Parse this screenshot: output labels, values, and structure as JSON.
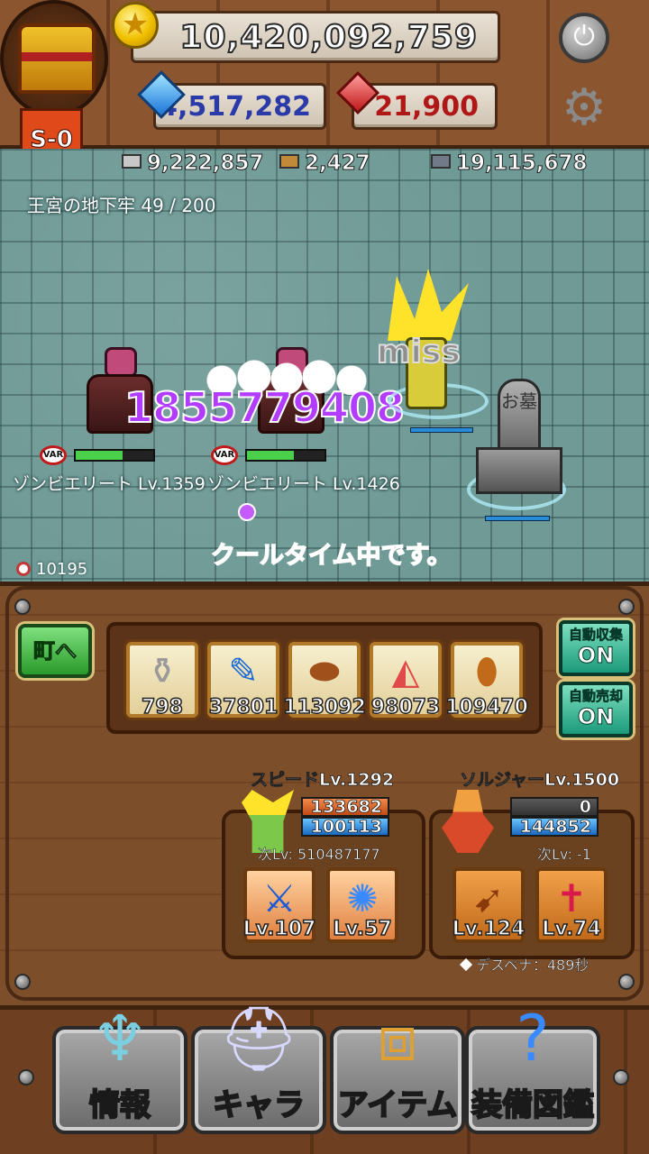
{
  "hud": {
    "gold": "10,420,092,759",
    "gems": "4,517,282",
    "rubies": "21,900",
    "stage": "S-0",
    "colors": {
      "gold_coin": "#f0c000",
      "gem": "#1b74d8",
      "ruby": "#c01a1a"
    }
  },
  "resources": {
    "ore": "9,222,857",
    "wood": "2,427",
    "stone": "19,115,678"
  },
  "field": {
    "dungeon": "王宮の地下牢 49 / 200",
    "damage": "1855779408",
    "miss": "miss",
    "cooldown": "クールタイム中です。",
    "kill_count": "10195",
    "grave_text": "お墓",
    "enemies": [
      {
        "name": "ゾンビエリート Lv.1359",
        "badge": "VAR",
        "hp": 0.6
      },
      {
        "name": "ゾンビエリート Lv.1426",
        "badge": "VAR",
        "hp": 0.6
      }
    ]
  },
  "panel": {
    "town_button": "町へ",
    "items": [
      {
        "icon": "potion-icon",
        "count": "798"
      },
      {
        "icon": "feather-icon",
        "count": "37801"
      },
      {
        "icon": "bread-icon",
        "count": "113092"
      },
      {
        "icon": "cake-icon",
        "count": "98073"
      },
      {
        "icon": "meat-icon",
        "count": "109470"
      }
    ],
    "auto_collect": {
      "label": "自動収集",
      "state": "ON"
    },
    "auto_sell": {
      "label": "自動売却",
      "state": "ON"
    },
    "characters": [
      {
        "name": "スピードLv.1292",
        "stat_top": "133682",
        "stat_bottom": "100113",
        "next_lv": "次Lv: 510487177",
        "skills": [
          {
            "icon": "sword-icon",
            "lv": "Lv.107"
          },
          {
            "icon": "frost-ring-icon",
            "lv": "Lv.57"
          }
        ]
      },
      {
        "name": "ソルジャーLv.1500",
        "stat_top": "0",
        "stat_bottom": "144852",
        "next_lv": "次Lv: -1",
        "skills": [
          {
            "icon": "arrow-icon",
            "lv": "Lv.124"
          },
          {
            "icon": "holy-sword-icon",
            "lv": "Lv.74"
          }
        ]
      }
    ],
    "death_penalty": "デスペナ：489秒"
  },
  "nav": {
    "items": [
      {
        "label": "情報",
        "icon": "info-emblem-icon"
      },
      {
        "label": "キャラ",
        "icon": "helmet-icon"
      },
      {
        "label": "アイテム",
        "icon": "chest-icon"
      },
      {
        "label": "装備図鑑",
        "icon": "book-icon"
      }
    ]
  }
}
